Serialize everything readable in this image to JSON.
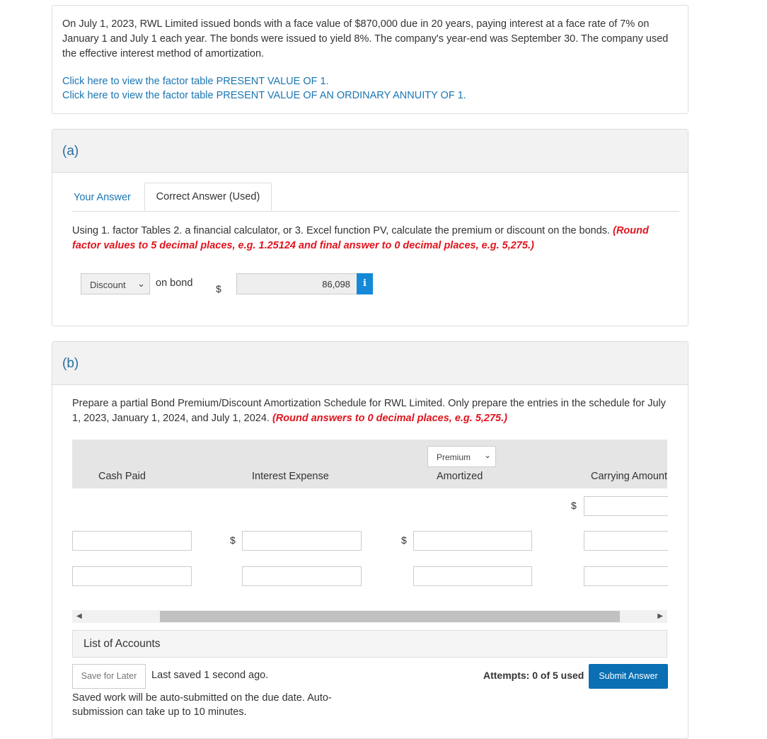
{
  "problem": {
    "text": "On July 1, 2023, RWL Limited issued bonds with a face value of $870,000 due in 20 years, paying interest at a face rate of 7% on January 1 and July 1 each year. The bonds were issued to yield 8%. The company's year-end was September 30. The company used the effective interest method of amortization.",
    "link1": "Click here to view the factor table PRESENT VALUE OF 1.",
    "link2": "Click here to view the factor table PRESENT VALUE OF AN ORDINARY ANNUITY OF 1."
  },
  "part_a": {
    "label": "(a)",
    "tabs": [
      "Your Answer",
      "Correct Answer (Used)"
    ],
    "instruction": "Using 1. factor Tables 2. a financial calculator, or 3. Excel function PV, calculate the premium or discount on the bonds. ",
    "instruction_red": "(Round factor values to 5 decimal places, e.g. 1.25124 and final answer to 0 decimal places, e.g. 5,275.)",
    "select_value": "Discount",
    "on_bond": "on bond",
    "dollar": "$",
    "answer": "86,098",
    "info_icon": "info-icon"
  },
  "part_b": {
    "label": "(b)",
    "instruction": "Prepare a partial Bond Premium/Discount Amortization Schedule for RWL Limited. Only prepare the entries in the schedule for July 1, 2023, January 1, 2024, and July 1, 2024. ",
    "instruction_red": "(Round answers to 0 decimal places, e.g. 5,275.)",
    "columns": [
      "Cash Paid",
      "Interest Expense",
      "Amortized",
      "Carrying Amount"
    ],
    "amortized_select": "Premium",
    "dollar": "$",
    "list_of_accounts": "List of Accounts"
  },
  "footer": {
    "save": "Save for Later",
    "last_saved": "Last saved 1 second ago.",
    "auto": "Saved work will be auto-submitted on the due date. Auto-submission can take up to 10 minutes.",
    "attempts": "Attempts: 0 of 5 used",
    "submit": "Submit Answer"
  },
  "colors": {
    "link": "#1a76b3",
    "red": "#e0141e",
    "submit": "#0a6fb3",
    "info": "#1589d8"
  }
}
